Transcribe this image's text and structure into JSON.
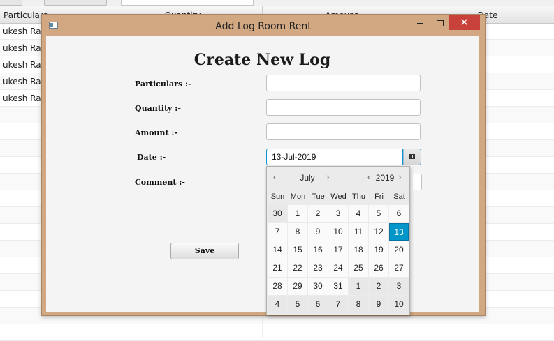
{
  "background_table": {
    "columns": [
      "Particulars",
      "Quantity",
      "Amount",
      "Date"
    ],
    "rows": [
      "ukesh Raghu",
      "ukesh Raghu",
      "ukesh Raghu",
      "ukesh Raghu",
      "ukesh Raghu"
    ]
  },
  "window": {
    "title": "Add Log Room Rent",
    "close_glyph": "✕"
  },
  "form": {
    "heading": "Create New Log",
    "labels": {
      "particulars": "Particulars :-",
      "quantity": "Quantity :-",
      "amount": "Amount :-",
      "date": "Date :-",
      "comment": "Comment  :-"
    },
    "values": {
      "particulars": "",
      "quantity": "",
      "amount": "",
      "date": "13-Jul-2019"
    },
    "save_label": "Save"
  },
  "date_picker": {
    "month": "July",
    "year": "2019",
    "prev_glyph": "‹",
    "next_glyph": "›",
    "weekdays": [
      "Sun",
      "Mon",
      "Tue",
      "Wed",
      "Thu",
      "Fri",
      "Sat"
    ],
    "weeks": [
      [
        {
          "d": "30",
          "o": true
        },
        {
          "d": "1"
        },
        {
          "d": "2"
        },
        {
          "d": "3"
        },
        {
          "d": "4"
        },
        {
          "d": "5"
        },
        {
          "d": "6"
        }
      ],
      [
        {
          "d": "7"
        },
        {
          "d": "8"
        },
        {
          "d": "9"
        },
        {
          "d": "10"
        },
        {
          "d": "11"
        },
        {
          "d": "12"
        },
        {
          "d": "13",
          "s": true
        }
      ],
      [
        {
          "d": "14"
        },
        {
          "d": "15"
        },
        {
          "d": "16"
        },
        {
          "d": "17"
        },
        {
          "d": "18"
        },
        {
          "d": "19"
        },
        {
          "d": "20"
        }
      ],
      [
        {
          "d": "21"
        },
        {
          "d": "22"
        },
        {
          "d": "23"
        },
        {
          "d": "24"
        },
        {
          "d": "25"
        },
        {
          "d": "26"
        },
        {
          "d": "27"
        }
      ],
      [
        {
          "d": "28"
        },
        {
          "d": "29"
        },
        {
          "d": "30"
        },
        {
          "d": "31"
        },
        {
          "d": "1",
          "o": true
        },
        {
          "d": "2",
          "o": true
        },
        {
          "d": "3",
          "o": true
        }
      ],
      [
        {
          "d": "4",
          "o": true
        },
        {
          "d": "5",
          "o": true
        },
        {
          "d": "6",
          "o": true
        },
        {
          "d": "7",
          "o": true
        },
        {
          "d": "8",
          "o": true
        },
        {
          "d": "9",
          "o": true
        },
        {
          "d": "10",
          "o": true
        }
      ]
    ],
    "selected_color": "#0096c9"
  },
  "colors": {
    "window_frame": "#d1a882",
    "close_button": "#c8413b",
    "focus_border": "#0f96d6"
  }
}
